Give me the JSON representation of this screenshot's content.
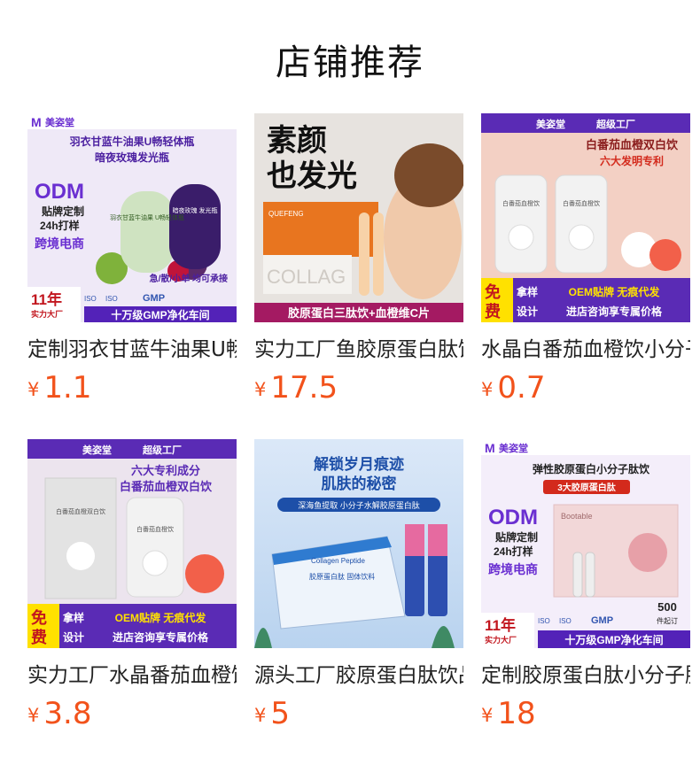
{
  "header": {
    "title": "店铺推荐"
  },
  "currency": "¥",
  "products": [
    {
      "name": "定制羽衣甘蓝牛油果U畅轻体瓶",
      "price": "1.1",
      "image": {
        "brand": "美姿堂",
        "headline1": "羽衣甘蓝牛油果U畅轻体瓶",
        "headline2": "暗夜玫瑰发光瓶",
        "odm": "ODM",
        "tag1": "贴牌定制",
        "tag2": "24h打样",
        "tag3": "跨境电商",
        "pouch1": "羽衣甘蓝牛油果 U畅轻体瓶",
        "pouch2": "暗夜玫瑰 发光瓶",
        "side": "急/散/小单 均可承接",
        "years": "11年",
        "factory": "实力大厂",
        "footer": "十万级GMP净化车间",
        "badges": [
          "ISO",
          "ISO",
          "GMP"
        ]
      }
    },
    {
      "name": "实力工厂鱼胶原蛋白肽饮",
      "price": "17.5",
      "image": {
        "headline1": "素颜",
        "headline2": "也发光",
        "box_brand": "QUEFENG",
        "box_text": "COLLAG",
        "footer": "胶原蛋白三肽饮+血橙维C片"
      }
    },
    {
      "name": "水晶白番茄血橙饮小分子",
      "price": "0.7",
      "image": {
        "brand": "美姿堂",
        "super": "超级工厂",
        "headline1": "白番茄血橙双白饮",
        "headline2": "六大发明专利",
        "pouch": "白番茄血橙饮",
        "free1": "免",
        "free2": "费",
        "tag1": "拿样",
        "tag2": "设计",
        "oem": "OEM贴牌  无痕代发",
        "footer": "进店咨询享专属价格"
      }
    },
    {
      "name": "实力工厂水晶番茄血橙饮",
      "price": "3.8",
      "image": {
        "brand": "美姿堂",
        "super": "超级工厂",
        "headline1": "六大专利成分",
        "headline2": "白番茄血橙双白饮",
        "box": "白番茄血橙双白饮",
        "pouch": "白番茄血橙饮",
        "free1": "免",
        "free2": "费",
        "tag1": "拿样",
        "tag2": "设计",
        "oem": "OEM贴牌  无痕代发",
        "footer": "进店咨询享专属价格"
      }
    },
    {
      "name": "源头工厂胶原蛋白肽饮品",
      "price": "5",
      "image": {
        "headline1": "解锁岁月痕迹",
        "headline2": "肌肤的秘密",
        "sub": "深海鱼提取 小分子水解胶原蛋白肽",
        "box_en": "Collagen Peptide",
        "box_cn": "胶原蛋白肽 固体饮料"
      }
    },
    {
      "name": "定制胶原蛋白肽小分子肽饮",
      "price": "18",
      "image": {
        "brand": "美姿堂",
        "headline1": "弹性胶原蛋白小分子肽饮",
        "headline2": "3大胶原蛋白肽",
        "odm": "ODM",
        "tag1": "贴牌定制",
        "tag2": "24h打样",
        "tag3": "跨境电商",
        "box_brand": "Bootable",
        "moq": "500",
        "moq_unit": "件起订",
        "years": "11年",
        "factory": "实力大厂",
        "footer": "十万级GMP净化车间",
        "badges": [
          "ISO",
          "ISO",
          "GMP"
        ]
      }
    }
  ]
}
